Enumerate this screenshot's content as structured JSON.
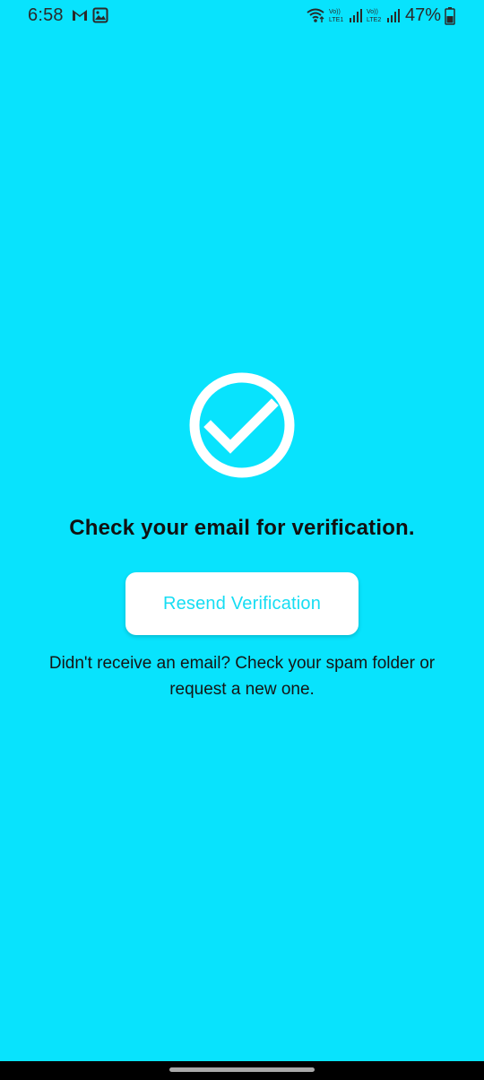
{
  "status_bar": {
    "time": "6:58",
    "battery_percent": "47%",
    "icons": [
      "gmail-icon",
      "gallery-icon",
      "wifi-icon",
      "lte1-signal-icon",
      "lte2-signal-icon",
      "battery-icon"
    ],
    "lte1_label_top": "Vo))",
    "lte1_label_bottom": "LTE1",
    "lte2_label_top": "Vo))",
    "lte2_label_bottom": "LTE2"
  },
  "colors": {
    "background": "#08E3FD",
    "button_background": "#FFFFFF",
    "button_text": "#16DDF3",
    "heading_text": "#111111",
    "nav_bar": "#000000"
  },
  "main": {
    "icon": "check-circle-icon",
    "message": "Check your email for verification.",
    "resend_label": "Resend Verification",
    "hint_text": "Didn't receive an email? Check your spam folder or request a new one."
  },
  "navigation": {
    "home_indicator": "home-indicator"
  }
}
